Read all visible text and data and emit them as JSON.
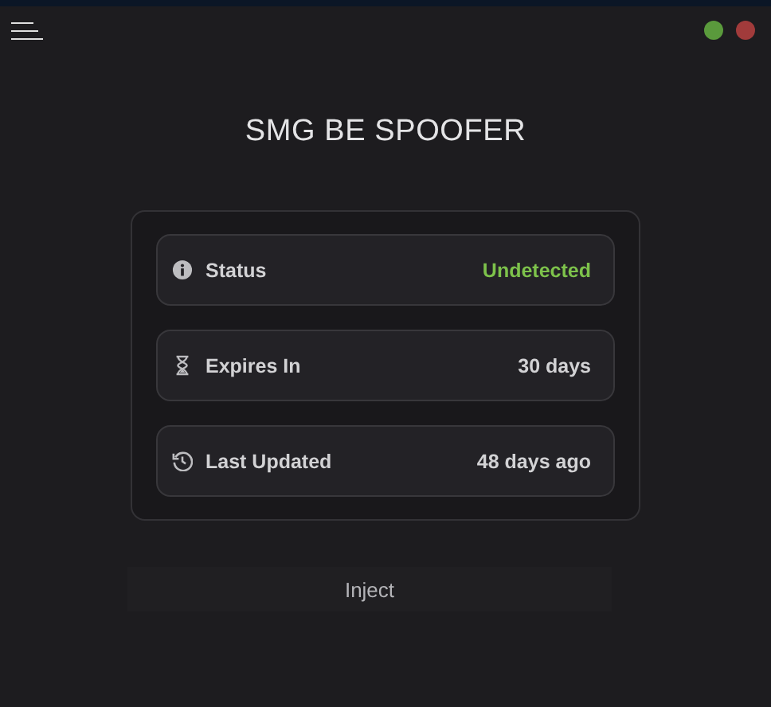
{
  "window_controls": [
    {
      "color": "#5a9a3c"
    },
    {
      "color": "#a13b3b"
    }
  ],
  "title": "SMG BE SPOOFER",
  "info_rows": [
    {
      "kind": "info",
      "label": "Status",
      "value": "Undetected",
      "color": "#7dc24b"
    },
    {
      "kind": "hourglass",
      "label": "Expires In",
      "value": "30 days",
      "color": "#d2d2d4"
    },
    {
      "kind": "history",
      "label": "Last Updated",
      "value": "48 days ago",
      "color": "#d2d2d4"
    }
  ],
  "button": "Inject"
}
